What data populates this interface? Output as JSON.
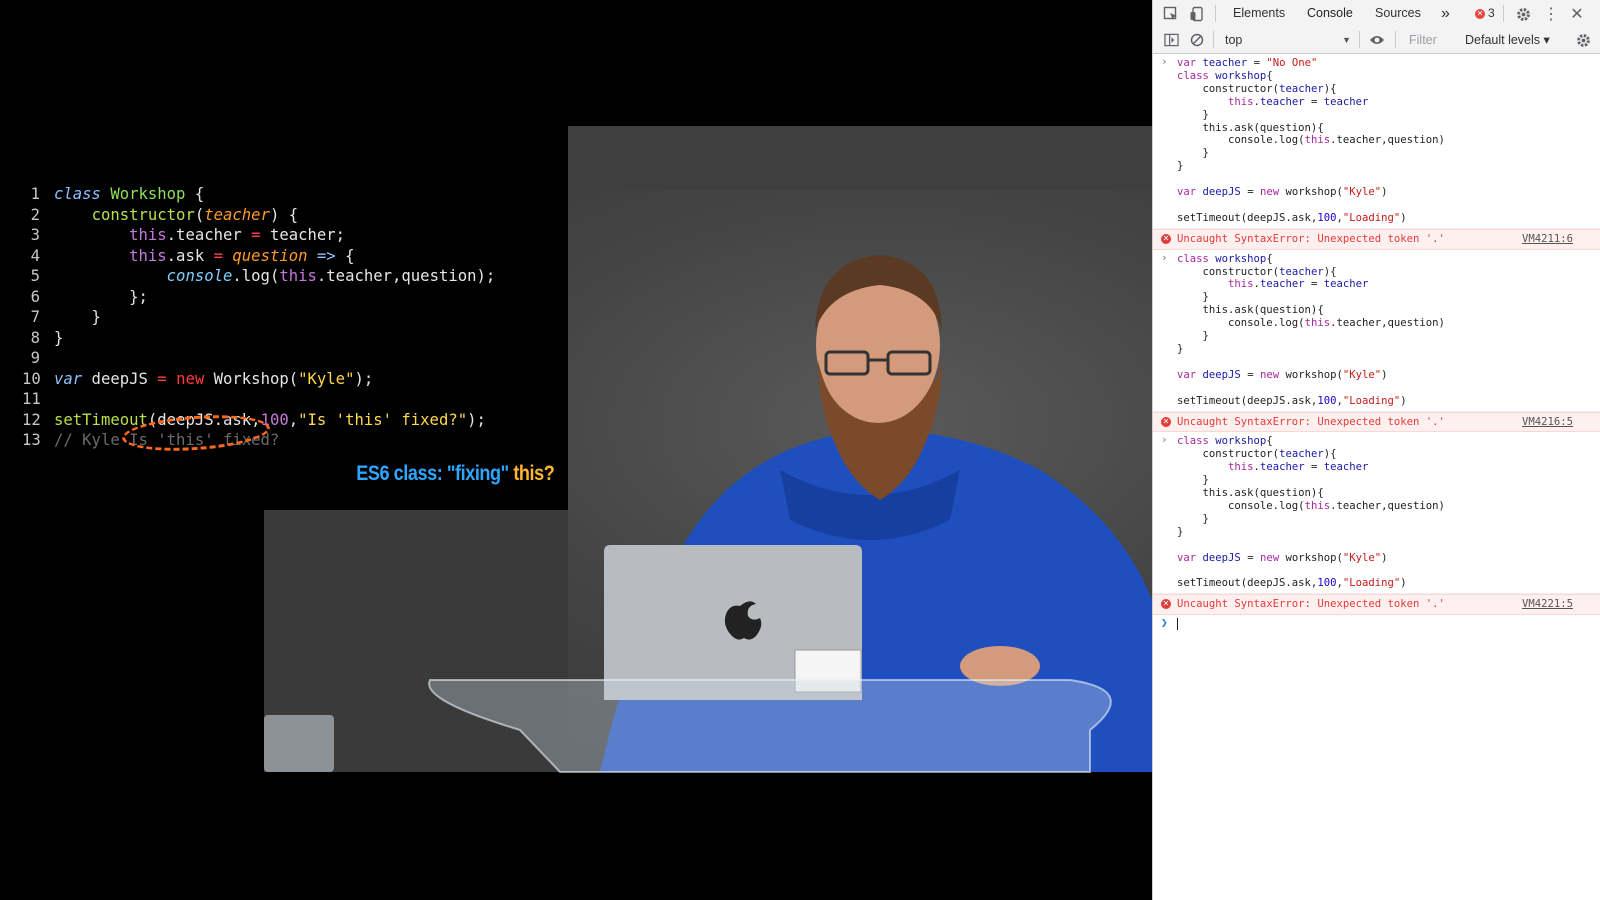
{
  "video": {
    "slide": {
      "lines": [
        {
          "n": "1",
          "segs": [
            {
              "t": "class",
              "c": "kw"
            },
            {
              "t": " "
            },
            {
              "t": "Workshop",
              "c": "cls"
            },
            {
              "t": " {"
            }
          ]
        },
        {
          "n": "2",
          "segs": [
            {
              "t": "    "
            },
            {
              "t": "constructor",
              "c": "fn"
            },
            {
              "t": "("
            },
            {
              "t": "teacher",
              "c": "param"
            },
            {
              "t": ") {"
            }
          ]
        },
        {
          "n": "3",
          "segs": [
            {
              "t": "        "
            },
            {
              "t": "this",
              "c": "this"
            },
            {
              "t": ".teacher "
            },
            {
              "t": "=",
              "c": "op"
            },
            {
              "t": " teacher;"
            }
          ]
        },
        {
          "n": "4",
          "segs": [
            {
              "t": "        "
            },
            {
              "t": "this",
              "c": "this"
            },
            {
              "t": ".ask "
            },
            {
              "t": "=",
              "c": "op"
            },
            {
              "t": " "
            },
            {
              "t": "question",
              "c": "param"
            },
            {
              "t": " "
            },
            {
              "t": "=>",
              "c": "kw"
            },
            {
              "t": " {"
            }
          ]
        },
        {
          "n": "5",
          "segs": [
            {
              "t": "            "
            },
            {
              "t": "console",
              "c": "console"
            },
            {
              "t": ".log("
            },
            {
              "t": "this",
              "c": "this"
            },
            {
              "t": ".teacher,question);"
            }
          ]
        },
        {
          "n": "6",
          "segs": [
            {
              "t": "        };"
            }
          ]
        },
        {
          "n": "7",
          "segs": [
            {
              "t": "    }"
            }
          ]
        },
        {
          "n": "8",
          "segs": [
            {
              "t": "}"
            }
          ]
        },
        {
          "n": "9",
          "segs": []
        },
        {
          "n": "10",
          "segs": [
            {
              "t": "var",
              "c": "kw"
            },
            {
              "t": " deepJS "
            },
            {
              "t": "=",
              "c": "op"
            },
            {
              "t": " "
            },
            {
              "t": "new",
              "c": "new"
            },
            {
              "t": " Workshop("
            },
            {
              "t": "\"Kyle\"",
              "c": "str"
            },
            {
              "t": ");"
            }
          ]
        },
        {
          "n": "11",
          "segs": []
        },
        {
          "n": "12",
          "segs": [
            {
              "t": "setTimeout",
              "c": "fn"
            },
            {
              "t": "(deepJS.ask,"
            },
            {
              "t": "100",
              "c": "num"
            },
            {
              "t": ","
            },
            {
              "t": "\"Is 'this' fixed?\"",
              "c": "str"
            },
            {
              "t": ");"
            }
          ]
        },
        {
          "n": "13",
          "segs": [
            {
              "t": "// Kyle Is 'this' fixed?",
              "c": "cmt"
            }
          ]
        }
      ],
      "caption_a": "ES6 class: \"fixing\"",
      "caption_b": " this?"
    }
  },
  "devtools": {
    "tabs": [
      "Elements",
      "Console",
      "Sources"
    ],
    "more_tabs": "»",
    "error_count": "3",
    "context": "top",
    "filter_placeholder": "Filter",
    "levels": "Default levels ▾",
    "console": [
      {
        "kind": "input",
        "lines": [
          [
            {
              "t": "var",
              "c": "c-kw"
            },
            {
              "t": " "
            },
            {
              "t": "teacher",
              "c": "c-def"
            },
            {
              "t": " = "
            },
            {
              "t": "\"No One\"",
              "c": "c-str"
            }
          ],
          [
            {
              "t": "class",
              "c": "c-kw"
            },
            {
              "t": " "
            },
            {
              "t": "workshop",
              "c": "c-def"
            },
            {
              "t": "{"
            }
          ],
          [
            {
              "t": "    constructor("
            },
            {
              "t": "teacher",
              "c": "c-def"
            },
            {
              "t": "){"
            }
          ],
          [
            {
              "t": "        "
            },
            {
              "t": "this",
              "c": "c-this"
            },
            {
              "t": "."
            },
            {
              "t": "teacher",
              "c": "c-def"
            },
            {
              "t": " = "
            },
            {
              "t": "teacher",
              "c": "c-def"
            }
          ],
          [
            {
              "t": "    }"
            }
          ],
          [
            {
              "t": "    this.ask(question){"
            }
          ],
          [
            {
              "t": "        console.log("
            },
            {
              "t": "this",
              "c": "c-this"
            },
            {
              "t": ".teacher,question)"
            }
          ],
          [
            {
              "t": "    }"
            }
          ],
          [
            {
              "t": "}"
            }
          ],
          [
            {
              "t": ""
            }
          ],
          [
            {
              "t": "var",
              "c": "c-kw"
            },
            {
              "t": " "
            },
            {
              "t": "deepJS",
              "c": "c-def"
            },
            {
              "t": " = "
            },
            {
              "t": "new",
              "c": "c-kw"
            },
            {
              "t": " workshop("
            },
            {
              "t": "\"Kyle\"",
              "c": "c-str"
            },
            {
              "t": ")"
            }
          ],
          [
            {
              "t": ""
            }
          ],
          [
            {
              "t": "setTimeout(deepJS.ask,"
            },
            {
              "t": "100",
              "c": "c-num"
            },
            {
              "t": ","
            },
            {
              "t": "\"Loading\"",
              "c": "c-str"
            },
            {
              "t": ")"
            }
          ]
        ]
      },
      {
        "kind": "error",
        "text": "Uncaught SyntaxError: Unexpected token '.'",
        "source": "VM4211:6"
      },
      {
        "kind": "input",
        "lines": [
          [
            {
              "t": "class",
              "c": "c-kw"
            },
            {
              "t": " "
            },
            {
              "t": "workshop",
              "c": "c-def"
            },
            {
              "t": "{"
            }
          ],
          [
            {
              "t": "    constructor("
            },
            {
              "t": "teacher",
              "c": "c-def"
            },
            {
              "t": "){"
            }
          ],
          [
            {
              "t": "        "
            },
            {
              "t": "this",
              "c": "c-this"
            },
            {
              "t": "."
            },
            {
              "t": "teacher",
              "c": "c-def"
            },
            {
              "t": " = "
            },
            {
              "t": "teacher",
              "c": "c-def"
            }
          ],
          [
            {
              "t": "    }"
            }
          ],
          [
            {
              "t": "    this.ask(question){"
            }
          ],
          [
            {
              "t": "        console.log("
            },
            {
              "t": "this",
              "c": "c-this"
            },
            {
              "t": ".teacher,question)"
            }
          ],
          [
            {
              "t": "    }"
            }
          ],
          [
            {
              "t": "}"
            }
          ],
          [
            {
              "t": ""
            }
          ],
          [
            {
              "t": "var",
              "c": "c-kw"
            },
            {
              "t": " "
            },
            {
              "t": "deepJS",
              "c": "c-def"
            },
            {
              "t": " = "
            },
            {
              "t": "new",
              "c": "c-kw"
            },
            {
              "t": " workshop("
            },
            {
              "t": "\"Kyle\"",
              "c": "c-str"
            },
            {
              "t": ")"
            }
          ],
          [
            {
              "t": ""
            }
          ],
          [
            {
              "t": "setTimeout(deepJS.ask,"
            },
            {
              "t": "100",
              "c": "c-num"
            },
            {
              "t": ","
            },
            {
              "t": "\"Loading\"",
              "c": "c-str"
            },
            {
              "t": ")"
            }
          ]
        ]
      },
      {
        "kind": "error",
        "text": "Uncaught SyntaxError: Unexpected token '.'",
        "source": "VM4216:5"
      },
      {
        "kind": "input",
        "lines": [
          [
            {
              "t": "class",
              "c": "c-kw"
            },
            {
              "t": " "
            },
            {
              "t": "workshop",
              "c": "c-def"
            },
            {
              "t": "{"
            }
          ],
          [
            {
              "t": "    constructor("
            },
            {
              "t": "teacher",
              "c": "c-def"
            },
            {
              "t": "){"
            }
          ],
          [
            {
              "t": "        "
            },
            {
              "t": "this",
              "c": "c-this"
            },
            {
              "t": "."
            },
            {
              "t": "teacher",
              "c": "c-def"
            },
            {
              "t": " = "
            },
            {
              "t": "teacher",
              "c": "c-def"
            }
          ],
          [
            {
              "t": "    }"
            }
          ],
          [
            {
              "t": "    this.ask(question){"
            }
          ],
          [
            {
              "t": "        console.log("
            },
            {
              "t": "this",
              "c": "c-this"
            },
            {
              "t": ".teacher,question)"
            }
          ],
          [
            {
              "t": "    }"
            }
          ],
          [
            {
              "t": "}"
            }
          ],
          [
            {
              "t": ""
            }
          ],
          [
            {
              "t": "var",
              "c": "c-kw"
            },
            {
              "t": " "
            },
            {
              "t": "deepJS",
              "c": "c-def"
            },
            {
              "t": " = "
            },
            {
              "t": "new",
              "c": "c-kw"
            },
            {
              "t": " workshop("
            },
            {
              "t": "\"Kyle\"",
              "c": "c-str"
            },
            {
              "t": ")"
            }
          ],
          [
            {
              "t": ""
            }
          ],
          [
            {
              "t": "setTimeout(deepJS.ask,"
            },
            {
              "t": "100",
              "c": "c-num"
            },
            {
              "t": ","
            },
            {
              "t": "\"Loading\"",
              "c": "c-str"
            },
            {
              "t": ")"
            }
          ]
        ]
      },
      {
        "kind": "error",
        "text": "Uncaught SyntaxError: Unexpected token '.'",
        "source": "VM4221:5"
      }
    ]
  }
}
